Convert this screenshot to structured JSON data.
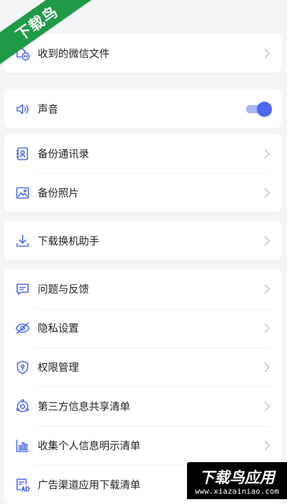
{
  "watermarks": {
    "top_left": "下载鸟",
    "bottom_right_title": "下载鸟应用",
    "bottom_right_url": "www.xiazainiao.com"
  },
  "colors": {
    "accent": "#4a68f0",
    "toggle_track": "#a9b6f7",
    "icon": "#4a68f0",
    "ribbon": "#1f9b47"
  },
  "groups": [
    {
      "items": [
        {
          "label": "收到的微信文件",
          "icon": "wechat-file-icon",
          "type": "chevron"
        }
      ]
    },
    {
      "items": [
        {
          "label": "声音",
          "icon": "speaker-icon",
          "type": "toggle",
          "enabled": true
        }
      ]
    },
    {
      "items": [
        {
          "label": "备份通讯录",
          "icon": "contacts-icon",
          "type": "chevron"
        },
        {
          "label": "备份照片",
          "icon": "photo-icon",
          "type": "chevron"
        }
      ]
    },
    {
      "items": [
        {
          "label": "下载换机助手",
          "icon": "download-icon",
          "type": "chevron"
        }
      ]
    },
    {
      "items": [
        {
          "label": "问题与反馈",
          "icon": "feedback-icon",
          "type": "chevron"
        },
        {
          "label": "隐私设置",
          "icon": "privacy-eye-icon",
          "type": "chevron"
        },
        {
          "label": "权限管理",
          "icon": "shield-icon",
          "type": "chevron"
        },
        {
          "label": "第三方信息共享清单",
          "icon": "share-icon",
          "type": "chevron"
        },
        {
          "label": "收集个人信息明示清单",
          "icon": "bar-chart-icon",
          "type": "chevron"
        },
        {
          "label": "广告渠道应用下载清单",
          "icon": "ad-icon",
          "type": "chevron"
        }
      ]
    }
  ]
}
